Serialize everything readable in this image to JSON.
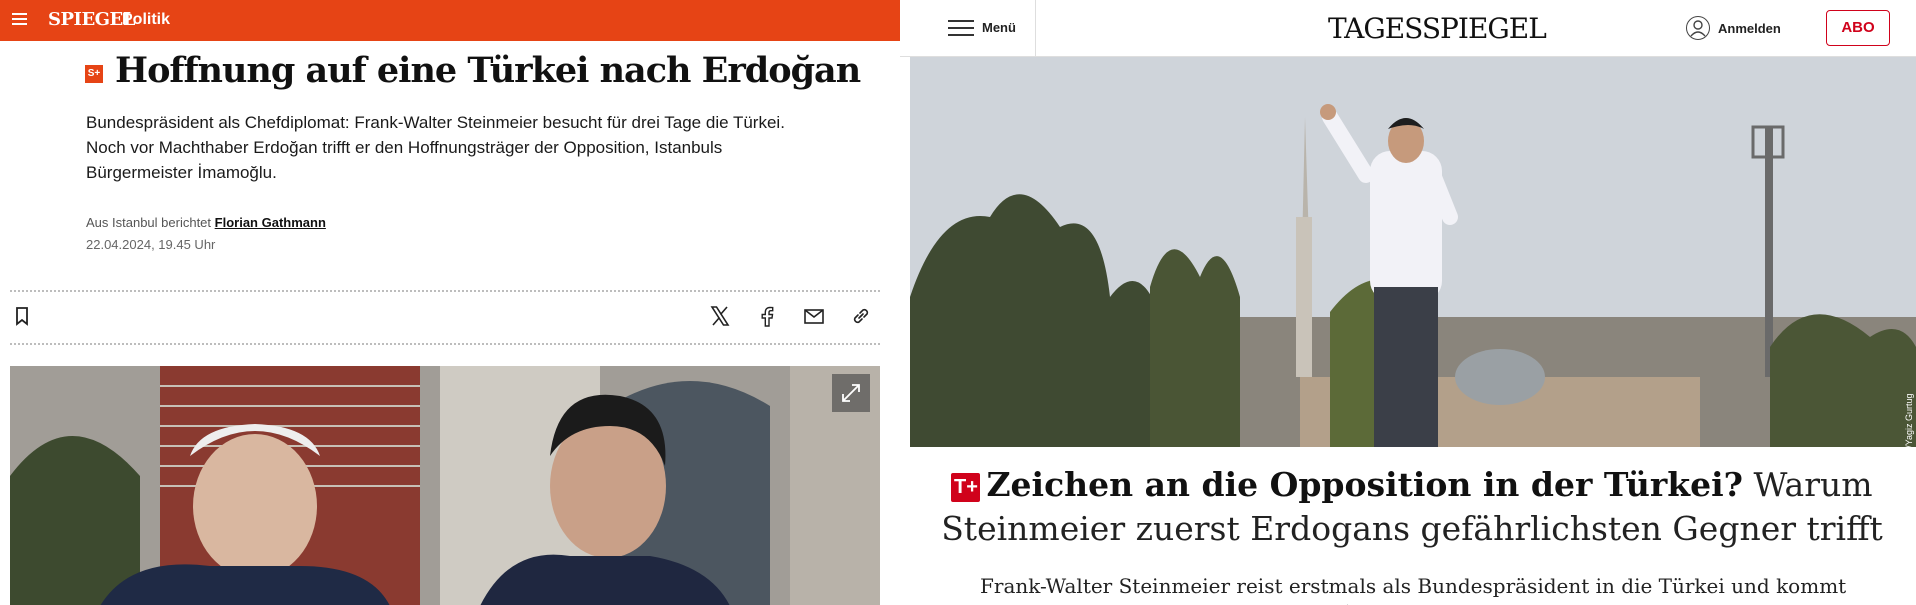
{
  "spiegel": {
    "logo": "SPIEGEL",
    "section": "Politik",
    "plus_badge": "S+",
    "headline": "Hoffnung auf eine Türkei nach Erdoğan",
    "teaser": "Bundespräsident als Chefdiplomat: Frank-Walter Steinmeier besucht für drei Tage die Türkei. Noch vor Machthaber Erdoğan trifft er den Hoffnungsträger der Opposition, Istanbuls Bürgermeister İmamoğlu.",
    "byline_prefix": "Aus Istanbul berichtet",
    "author": "Florian Gathmann",
    "date": "22.04.2024, 19.45 Uhr",
    "share_icons": [
      "bookmark-icon",
      "x-icon",
      "facebook-icon",
      "mail-icon",
      "link-icon"
    ],
    "brand_color": "#e64415"
  },
  "tagesspiegel": {
    "menu_label": "Menü",
    "logo": "TAGESSPIEGEL",
    "login_label": "Anmelden",
    "abo_label": "ABO",
    "photo_credit": "© IMAGO/Yagiz Gurtug",
    "plus_badge": "T+",
    "headline_bold": "Zeichen an die Opposition in der Türkei?",
    "headline_rest": "Warum Steinmeier zuerst Erdogans gefährlichsten Gegner trifft",
    "teaser": "Frank-Walter Steinmeier reist erstmals als Bundespräsident in die Türkei und kommt zuerst mit Istanbuls Bürgermeister İmamoğlu zusammen. Statt auf Erdoğan trifft er...",
    "brand_color": "#d0021b"
  }
}
